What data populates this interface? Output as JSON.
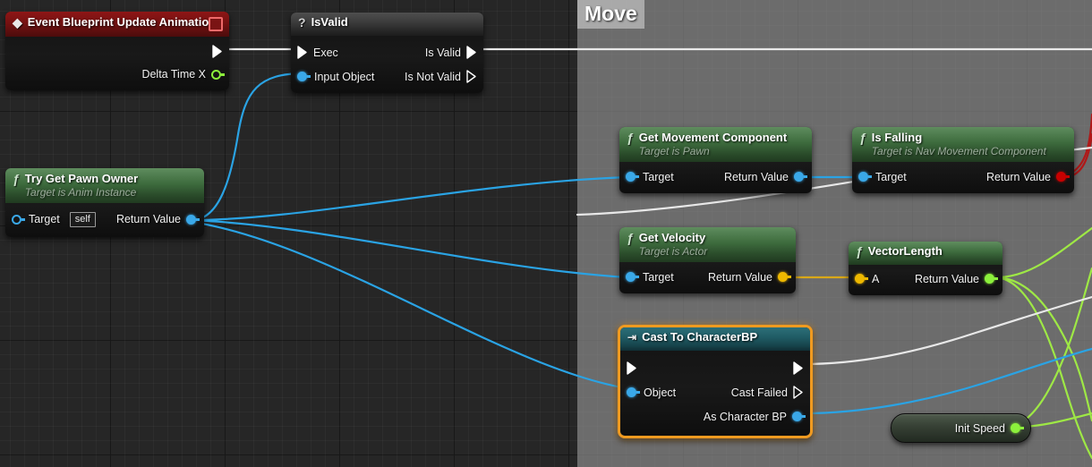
{
  "app": {
    "name": "Unreal Engine Blueprint Event Graph",
    "background_color": "#262626",
    "grid_line_color": "#303030"
  },
  "comment": {
    "title": "Move",
    "fill_color": "#989898",
    "title_bar_color": "#b9b9b9"
  },
  "colors": {
    "exec_white": "#ffffff",
    "object_blue": "#3aa8e8",
    "boolean_red": "#c80000",
    "float_green": "#8cf03c",
    "vector_gold": "#eeb800",
    "selection_orange": "#f09a20",
    "event_red_header": "#8e1616",
    "function_green_header": "#3d6b3d",
    "cast_teal_header": "#1f5a63",
    "pure_gray_header": "#3a3a3a"
  },
  "nodes": {
    "event_update_animation": {
      "title": "Event Blueprint Update Animation",
      "icon": "event-diamond-icon",
      "header_button": "breakpoint-square-icon",
      "outputs": [
        {
          "label": "",
          "pin": "exec-pin",
          "color": "#ffffff"
        },
        {
          "label": "Delta Time X",
          "pin": "float-pin",
          "color": "#8cf03c"
        }
      ]
    },
    "is_valid": {
      "title": "IsValid",
      "icon": "question-mark-icon",
      "inputs": [
        {
          "label": "Exec",
          "pin": "exec-pin",
          "color": "#ffffff"
        },
        {
          "label": "Input Object",
          "pin": "object-pin",
          "color": "#3aa8e8"
        }
      ],
      "outputs": [
        {
          "label": "Is Valid",
          "pin": "exec-pin-filled",
          "color": "#ffffff"
        },
        {
          "label": "Is Not Valid",
          "pin": "exec-pin-empty",
          "color": "#ffffff"
        }
      ]
    },
    "try_get_pawn_owner": {
      "title": "Try Get Pawn Owner",
      "subtitle": "Target is Anim Instance",
      "icon": "function-f-icon",
      "inputs": [
        {
          "label": "Target",
          "value": "self",
          "pin": "object-pin-ring",
          "color": "#3aa8e8"
        }
      ],
      "outputs": [
        {
          "label": "Return Value",
          "pin": "object-pin",
          "color": "#3aa8e8"
        }
      ]
    },
    "get_movement_component": {
      "title": "Get Movement Component",
      "subtitle": "Target is Pawn",
      "icon": "function-f-icon",
      "inputs": [
        {
          "label": "Target",
          "pin": "object-pin",
          "color": "#3aa8e8"
        }
      ],
      "outputs": [
        {
          "label": "Return Value",
          "pin": "object-pin",
          "color": "#3aa8e8"
        }
      ]
    },
    "is_falling": {
      "title": "Is Falling",
      "subtitle": "Target is Nav Movement Component",
      "icon": "function-f-icon",
      "inputs": [
        {
          "label": "Target",
          "pin": "object-pin",
          "color": "#3aa8e8"
        }
      ],
      "outputs": [
        {
          "label": "Return Value",
          "pin": "boolean-pin",
          "color": "#c80000"
        }
      ]
    },
    "get_velocity": {
      "title": "Get Velocity",
      "subtitle": "Target is Actor",
      "icon": "function-f-icon",
      "inputs": [
        {
          "label": "Target",
          "pin": "object-pin",
          "color": "#3aa8e8"
        }
      ],
      "outputs": [
        {
          "label": "Return Value",
          "pin": "vector-pin",
          "color": "#eeb800"
        }
      ]
    },
    "vector_length": {
      "title": "VectorLength",
      "icon": "function-f-icon",
      "inputs": [
        {
          "label": "A",
          "pin": "vector-pin",
          "color": "#eeb800"
        }
      ],
      "outputs": [
        {
          "label": "Return Value",
          "pin": "float-pin",
          "color": "#8cf03c"
        }
      ]
    },
    "cast_to_characterbp": {
      "title": "Cast To CharacterBP",
      "icon": "cast-arrow-icon",
      "selected": true,
      "inputs": [
        {
          "label": "",
          "pin": "exec-pin",
          "color": "#ffffff"
        },
        {
          "label": "Object",
          "pin": "object-pin",
          "color": "#3aa8e8"
        }
      ],
      "outputs": [
        {
          "label": "",
          "pin": "exec-pin-filled",
          "color": "#ffffff"
        },
        {
          "label": "Cast Failed",
          "pin": "exec-pin-empty",
          "color": "#ffffff"
        },
        {
          "label": "As Character BP",
          "pin": "object-pin",
          "color": "#3aa8e8"
        }
      ]
    },
    "init_speed": {
      "title": "Init Speed",
      "pin": "float-pin",
      "color": "#8cf03c"
    }
  }
}
